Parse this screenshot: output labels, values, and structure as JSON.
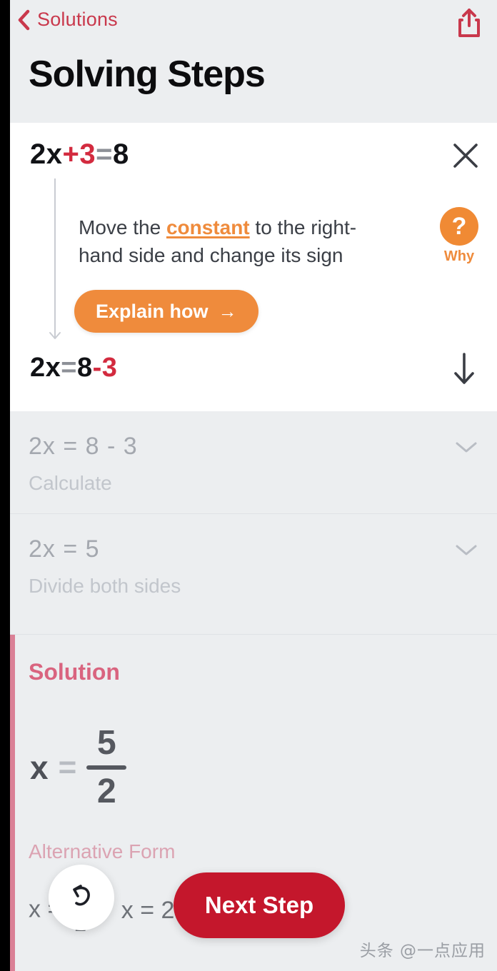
{
  "header": {
    "back_label": "Solutions",
    "back_icon": "chevron-left-icon",
    "title": "Solving Steps",
    "share_icon": "share-icon",
    "accent_color": "#c9384c"
  },
  "active_step": {
    "equation": {
      "lhs": "2x",
      "operator": "+3",
      "equals": "=",
      "rhs": "8"
    },
    "close_icon": "close-icon",
    "hint_prefix": "Move the ",
    "hint_term": "constant",
    "hint_suffix": " to the right-hand side and change its sign",
    "why": {
      "icon": "question-mark-icon",
      "label": "Why",
      "color": "#ef8b3c"
    },
    "explain_button": {
      "label": "Explain how",
      "arrow": "→",
      "color": "#ef8b3c"
    },
    "result": {
      "lhs": "2x",
      "equals": "=",
      "rhs": "8",
      "operator": "-3"
    },
    "down_icon": "arrow-down-icon"
  },
  "collapsed_steps": [
    {
      "equation": "2x = 8 - 3",
      "description": "Calculate",
      "chevron_icon": "chevron-down-icon"
    },
    {
      "equation": "2x = 5",
      "description": "Divide both sides",
      "chevron_icon": "chevron-down-icon"
    }
  ],
  "solution": {
    "title": "Solution",
    "variable": "x",
    "equals": "=",
    "numerator": "5",
    "denominator": "2",
    "alt_form_label": "Alternative Form",
    "alt_values": [
      {
        "variable": "x",
        "equals": "=",
        "numerator": "5",
        "denominator": "2"
      },
      {
        "text": "x = 2."
      }
    ],
    "accent_color": "#d9647f",
    "bar_color": "#da8096"
  },
  "bottom_controls": {
    "undo": {
      "icon": "undo-arrow-icon",
      "label": ""
    },
    "next_step": {
      "label": "Next Step",
      "color": "#c4172c"
    }
  },
  "watermark": "头条 @一点应用"
}
